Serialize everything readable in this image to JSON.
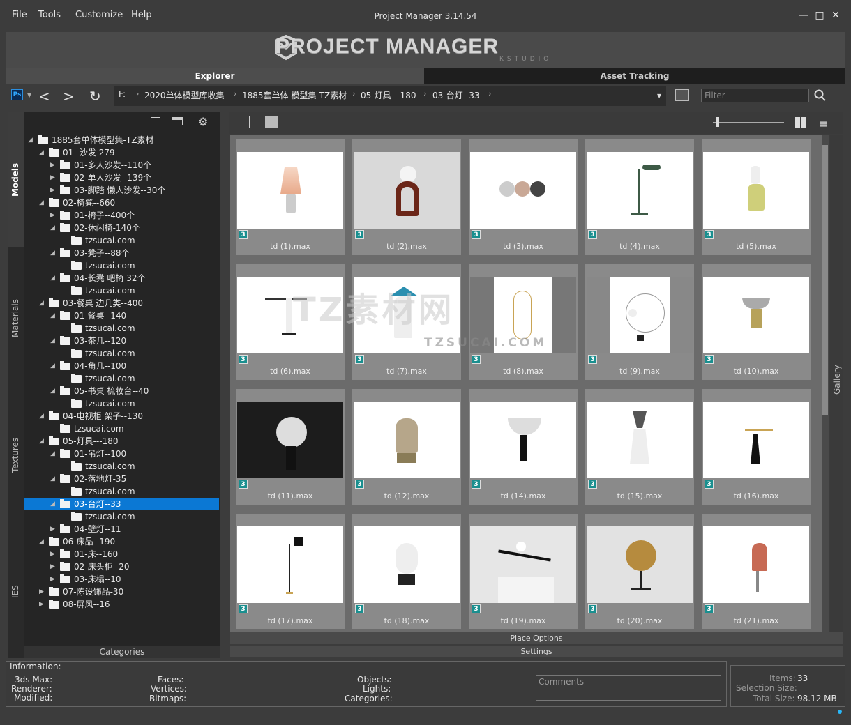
{
  "menu": [
    "File",
    "Tools",
    "Customize",
    "Help"
  ],
  "window_title": "Project Manager 3.14.54",
  "banner": {
    "logo": "PROJECT MANAGER",
    "sub": "KSTUDIO"
  },
  "tabs": [
    "Explorer",
    "Asset Tracking"
  ],
  "breadcrumb": [
    "F:",
    "2020单体模型库收集",
    "1885套单体 模型集-TZ素材",
    "05-灯具---180",
    "03-台灯--33"
  ],
  "filter_placeholder": "Filter",
  "side_tabs": [
    "Models",
    "Materials",
    "Textures",
    "IES"
  ],
  "tree": [
    {
      "label": "1885套单体模型集-TZ素材",
      "lvl": 0,
      "arrow": "open"
    },
    {
      "label": "01--沙发 279",
      "lvl": 1,
      "arrow": "open"
    },
    {
      "label": "01-多人沙发--110个",
      "lvl": 2,
      "arrow": "closed"
    },
    {
      "label": "02-单人沙发--139个",
      "lvl": 2,
      "arrow": "closed"
    },
    {
      "label": "03-脚踏 懒人沙发--30个",
      "lvl": 2,
      "arrow": "closed"
    },
    {
      "label": "02-椅凳--660",
      "lvl": 1,
      "arrow": "open"
    },
    {
      "label": "01-椅子--400个",
      "lvl": 2,
      "arrow": "closed"
    },
    {
      "label": "02-休闲椅-140个",
      "lvl": 2,
      "arrow": "open"
    },
    {
      "label": "tzsucai.com",
      "lvl": 3,
      "arrow": ""
    },
    {
      "label": "03-凳子--88个",
      "lvl": 2,
      "arrow": "open"
    },
    {
      "label": "tzsucai.com",
      "lvl": 3,
      "arrow": ""
    },
    {
      "label": "04-长凳 吧椅 32个",
      "lvl": 2,
      "arrow": "open"
    },
    {
      "label": "tzsucai.com",
      "lvl": 3,
      "arrow": ""
    },
    {
      "label": "03-餐桌 边几类--400",
      "lvl": 1,
      "arrow": "open"
    },
    {
      "label": "01-餐桌--140",
      "lvl": 2,
      "arrow": "open"
    },
    {
      "label": "tzsucai.com",
      "lvl": 3,
      "arrow": ""
    },
    {
      "label": "03-茶几--120",
      "lvl": 2,
      "arrow": "open"
    },
    {
      "label": "tzsucai.com",
      "lvl": 3,
      "arrow": ""
    },
    {
      "label": "04-角几--100",
      "lvl": 2,
      "arrow": "open"
    },
    {
      "label": "tzsucai.com",
      "lvl": 3,
      "arrow": ""
    },
    {
      "label": "05-书桌 梳妆台--40",
      "lvl": 2,
      "arrow": "open"
    },
    {
      "label": "tzsucai.com",
      "lvl": 3,
      "arrow": ""
    },
    {
      "label": "04-电视柜 架子--130",
      "lvl": 1,
      "arrow": "open"
    },
    {
      "label": "tzsucai.com",
      "lvl": 2,
      "arrow": ""
    },
    {
      "label": "05-灯具---180",
      "lvl": 1,
      "arrow": "open"
    },
    {
      "label": "01-吊灯--100",
      "lvl": 2,
      "arrow": "open"
    },
    {
      "label": "tzsucai.com",
      "lvl": 3,
      "arrow": ""
    },
    {
      "label": "02-落地灯-35",
      "lvl": 2,
      "arrow": "open"
    },
    {
      "label": "tzsucai.com",
      "lvl": 3,
      "arrow": ""
    },
    {
      "label": "03-台灯--33",
      "lvl": 2,
      "arrow": "open",
      "selected": true
    },
    {
      "label": "tzsucai.com",
      "lvl": 3,
      "arrow": ""
    },
    {
      "label": "04-壁灯--11",
      "lvl": 2,
      "arrow": "closed"
    },
    {
      "label": "06-床品--190",
      "lvl": 1,
      "arrow": "open"
    },
    {
      "label": "01-床--160",
      "lvl": 2,
      "arrow": "closed"
    },
    {
      "label": "02-床头柜--20",
      "lvl": 2,
      "arrow": "closed"
    },
    {
      "label": "03-床榻--10",
      "lvl": 2,
      "arrow": "closed"
    },
    {
      "label": "07-陈设饰品-30",
      "lvl": 1,
      "arrow": "closed"
    },
    {
      "label": "08-屏风--16",
      "lvl": 1,
      "arrow": "closed"
    }
  ],
  "categories_label": "Categories",
  "items": [
    "td (1).max",
    "td (2).max",
    "td (3).max",
    "td (4).max",
    "td (5).max",
    "td (6).max",
    "td (7).max",
    "td (8).max",
    "td (9).max",
    "td (10).max",
    "td (11).max",
    "td (12).max",
    "td (14).max",
    "td (15).max",
    "td (16).max",
    "td (17).max",
    "td (18).max",
    "td (19).max",
    "td (20).max",
    "td (21).max"
  ],
  "badge": "3",
  "gallery_label": "Gallery",
  "place_options": "Place Options",
  "settings": "Settings",
  "info": {
    "title": "Information:",
    "col1": [
      "3ds Max:",
      "Renderer:",
      "Modified:"
    ],
    "col2": [
      "Faces:",
      "Vertices:",
      "Bitmaps:"
    ],
    "col3": [
      "Objects:",
      "Lights:",
      "Categories:"
    ],
    "comments": "Comments"
  },
  "stats": {
    "items_label": "Items:",
    "items": "33",
    "sel_label": "Selection Size:",
    "sel": "",
    "total_label": "Total Size:",
    "total": "98.12 MB"
  },
  "watermark": {
    "big": "TZ素材网",
    "small": "TZSUCAI.COM"
  }
}
